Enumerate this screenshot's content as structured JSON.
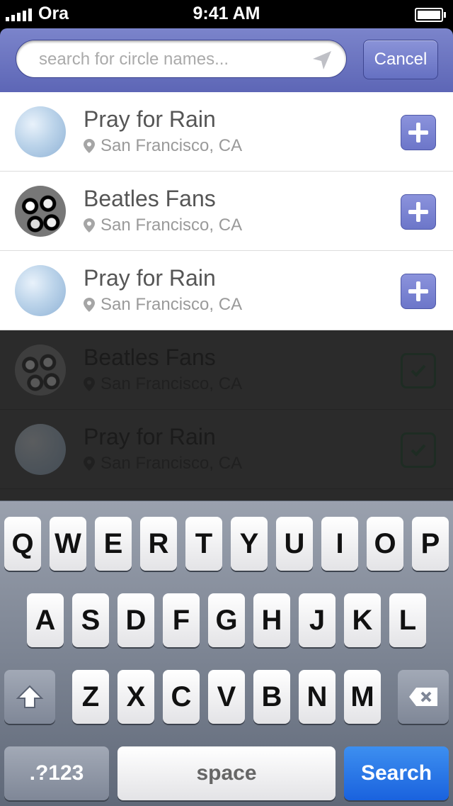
{
  "status_bar": {
    "carrier": "Ora",
    "time": "9:41 AM"
  },
  "search": {
    "placeholder": "search for circle names...",
    "value": "",
    "cancel_label": "Cancel"
  },
  "circles": [
    {
      "name": "Pray for Rain",
      "location": "San Francisco, CA",
      "avatar": "sky",
      "state": "add"
    },
    {
      "name": "Beatles Fans",
      "location": "San Francisco, CA",
      "avatar": "band",
      "state": "add"
    },
    {
      "name": "Pray for Rain",
      "location": "San Francisco, CA",
      "avatar": "sky",
      "state": "add"
    },
    {
      "name": "Beatles Fans",
      "location": "San Francisco, CA",
      "avatar": "band",
      "state": "joined"
    },
    {
      "name": "Pray for Rain",
      "location": "San Francisco, CA",
      "avatar": "sky",
      "state": "joined"
    }
  ],
  "keyboard": {
    "row1": [
      "Q",
      "W",
      "E",
      "R",
      "T",
      "Y",
      "U",
      "I",
      "O",
      "P"
    ],
    "row2": [
      "A",
      "S",
      "D",
      "F",
      "G",
      "H",
      "J",
      "K",
      "L"
    ],
    "row3": [
      "Z",
      "X",
      "C",
      "V",
      "B",
      "N",
      "M"
    ],
    "numbers_label": ".?123",
    "space_label": "space",
    "search_label": "Search"
  },
  "colors": {
    "accent": "#6c76c9",
    "keyboard_action": "#1a62de"
  }
}
